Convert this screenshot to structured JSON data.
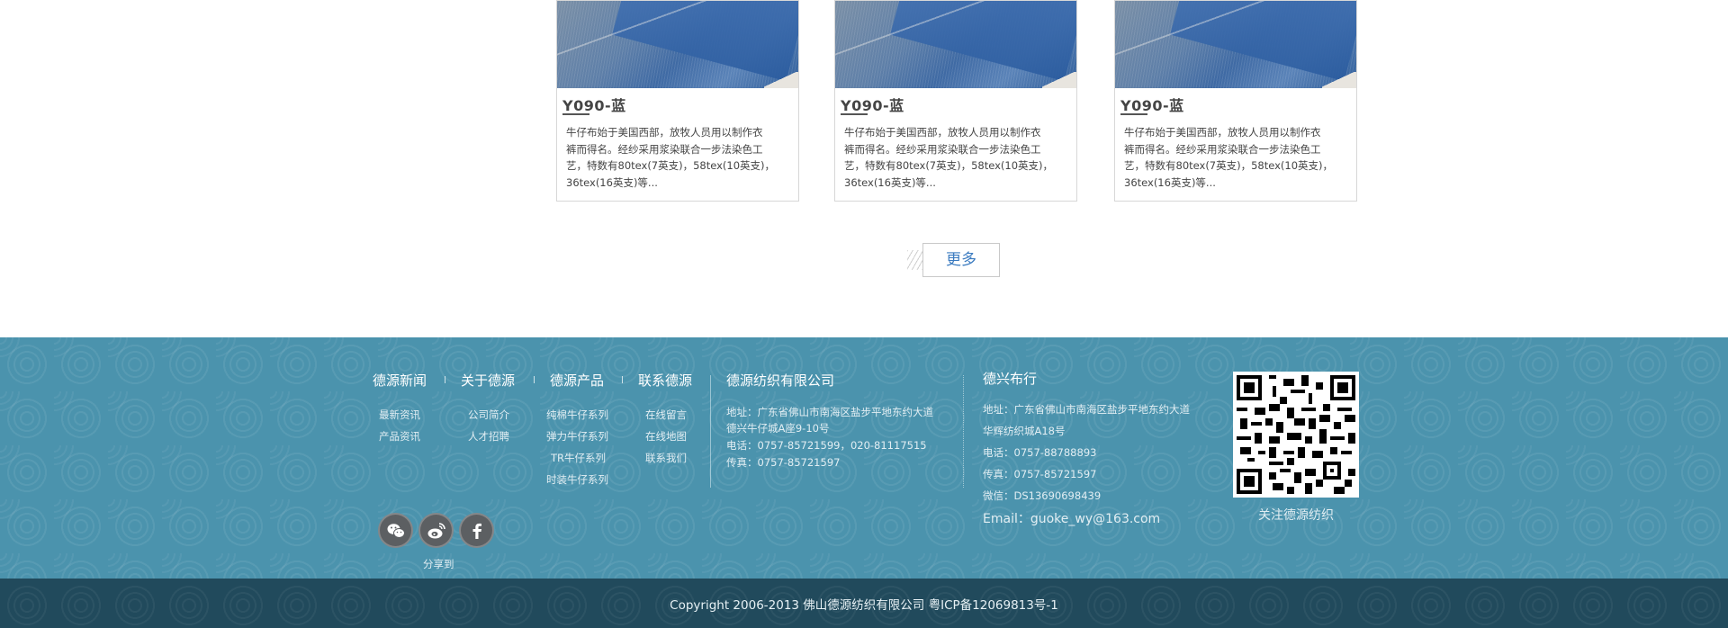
{
  "products": [
    {
      "title": "Y090-蓝",
      "desc_lines": [
        "牛仔布始于美国西部，放牧人员用以制作衣",
        "裤而得名。经纱采用浆染联合一步法染色工",
        "艺，特数有80tex(7英支)，58tex(10英支)，",
        "36tex(16英支)等..."
      ]
    },
    {
      "title": "Y090-蓝",
      "desc_lines": [
        "牛仔布始于美国西部，放牧人员用以制作衣",
        "裤而得名。经纱采用浆染联合一步法染色工",
        "艺，特数有80tex(7英支)，58tex(10英支)，",
        "36tex(16英支)等..."
      ]
    },
    {
      "title": "Y090-蓝",
      "desc_lines": [
        "牛仔布始于美国西部，放牧人员用以制作衣",
        "裤而得名。经纱采用浆染联合一步法染色工",
        "艺，特数有80tex(7英支)，58tex(10英支)，",
        "36tex(16英支)等..."
      ]
    }
  ],
  "more_label": "更多",
  "footer_nav": [
    {
      "heading": "德源新闻",
      "links": [
        "最新资讯",
        "产品资讯"
      ]
    },
    {
      "heading": "关于德源",
      "links": [
        "公司简介",
        "人才招聘"
      ]
    },
    {
      "heading": "德源产品",
      "links": [
        "纯棉牛仔系列",
        "弹力牛仔系列",
        "TR牛仔系列",
        "时装牛仔系列"
      ]
    },
    {
      "heading": "联系德源",
      "links": [
        "在线留言",
        "在线地图",
        "联系我们"
      ]
    }
  ],
  "company1": {
    "name": "德源纺织有限公司",
    "lines": [
      "地址：广东省佛山市南海区盐步平地东约大道",
      "德兴牛仔城A座9-10号",
      "电话：0757-85721599，020-81117515",
      "传真：0757-85721597"
    ]
  },
  "company2": {
    "name": "德兴布行",
    "lines": [
      "地址：广东省佛山市南海区盐步平地东约大道",
      "华辉纺织城A18号",
      "电话：0757-88788893",
      "传真：0757-85721597",
      "微信：DS13690698439"
    ],
    "email": "Email：guoke_wy@163.com"
  },
  "share_label": "分享到",
  "social_icons": [
    "wechat-icon",
    "weibo-icon",
    "facebook-icon"
  ],
  "qr_caption": "关注德源纺织",
  "copyright": "Copyright 2006-2013  佛山德源纺织有限公司   粤ICP备12069813号-1",
  "colors": {
    "footer_bg": "#4b93ad",
    "bottom_bar_bg": "#214a5c",
    "more_text": "#3b7bc0"
  }
}
